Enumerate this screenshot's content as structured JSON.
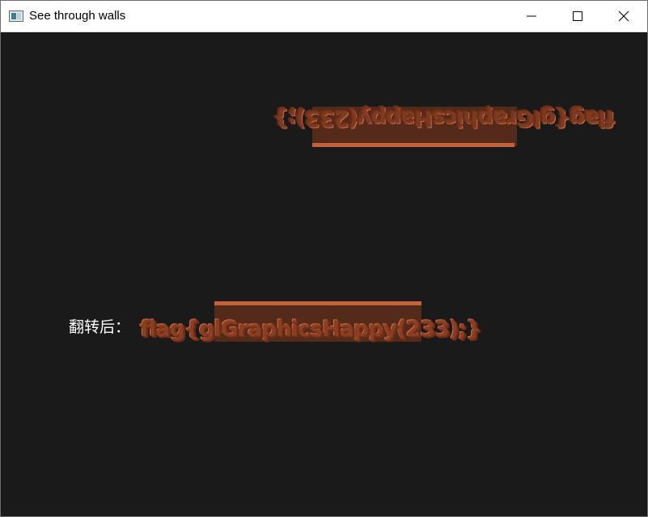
{
  "window": {
    "title": "See through walls",
    "controls": {
      "minimize_icon": "minimize-icon",
      "maximize_icon": "maximize-icon",
      "close_icon": "close-icon"
    }
  },
  "scene": {
    "flipped_text": "flag{glGraphicsHappy(233);}",
    "caption": "翻转后：",
    "normal_text": "flag{glGraphicsHappy(233);}",
    "colors": {
      "background": "#1a1a1a",
      "text_face": "#8a3f22",
      "box": "#542a1b",
      "highlight": "#c4623a"
    }
  }
}
